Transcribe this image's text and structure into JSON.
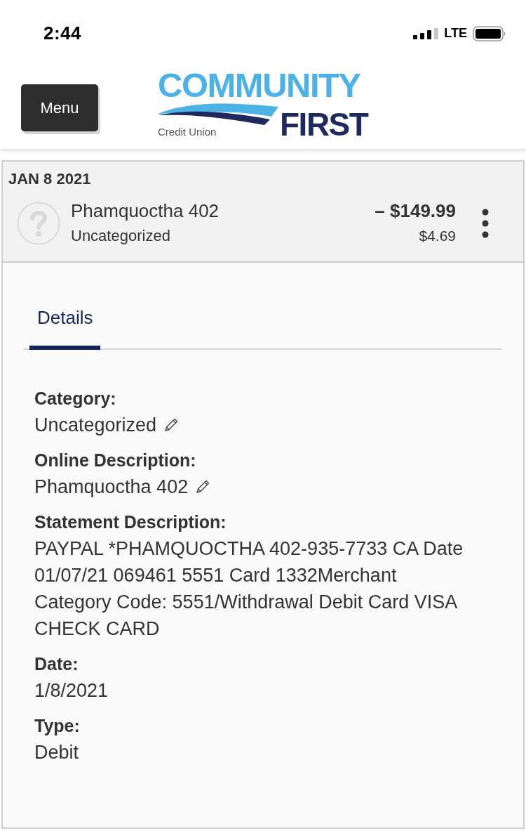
{
  "status_bar": {
    "time": "2:44",
    "network": "LTE"
  },
  "header": {
    "menu_button": "Menu",
    "logo": {
      "line_1": "COMMUNITY",
      "line_2": "FIRST",
      "tagline": "Credit Union"
    }
  },
  "transaction": {
    "date": "JAN 8 2021",
    "name": "Phamquoctha 402",
    "category": "Uncategorized",
    "amount": "– $149.99",
    "balance": "$4.69"
  },
  "tabs": [
    {
      "label": "Details",
      "selected": true
    }
  ],
  "details": [
    {
      "label": "Category:",
      "value": "Uncategorized",
      "editable": true
    },
    {
      "label": "Online Description:",
      "value": "Phamquoctha 402",
      "editable": true
    },
    {
      "label": "Statement Description:",
      "value": "PAYPAL *PHAMQUOCTHA 402-935-7733 CA Date 01/07/21 069461 5551 Card 1332Merchant Category Code: 5551/Withdrawal Debit Card VISA CHECK CARD",
      "editable": false
    },
    {
      "label": "Date:",
      "value": "1/8/2021",
      "editable": false
    },
    {
      "label": "Type:",
      "value": "Debit",
      "editable": false
    }
  ]
}
